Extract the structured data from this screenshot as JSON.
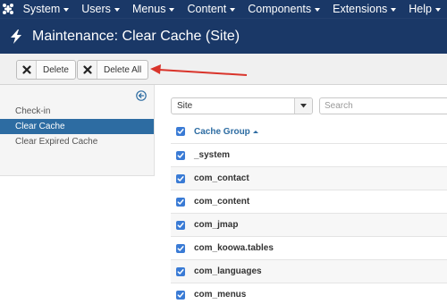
{
  "nav": {
    "logo_icon": "joomla-logo",
    "items": [
      {
        "label": "System",
        "has_caret": true
      },
      {
        "label": "Users",
        "has_caret": true
      },
      {
        "label": "Menus",
        "has_caret": true
      },
      {
        "label": "Content",
        "has_caret": true
      },
      {
        "label": "Components",
        "has_caret": true
      },
      {
        "label": "Extensions",
        "has_caret": true
      },
      {
        "label": "Help",
        "has_caret": true
      }
    ]
  },
  "header": {
    "icon": "lightning-icon",
    "title": "Maintenance: Clear Cache (Site)"
  },
  "toolbar": {
    "delete_label": "Delete",
    "delete_all_label": "Delete All",
    "annotation_color": "#d9342b"
  },
  "sidebar": {
    "collapse_icon": "arrow-left-circle-icon",
    "items": [
      {
        "label": "Check-in",
        "active": false
      },
      {
        "label": "Clear Cache",
        "active": true
      },
      {
        "label": "Clear Expired Cache",
        "active": false
      }
    ]
  },
  "filters": {
    "client_select_value": "Site",
    "search_placeholder": "Search"
  },
  "table": {
    "column_header": "Cache Group",
    "sort_direction": "ascending",
    "rows": [
      {
        "group": "_system",
        "checked": true
      },
      {
        "group": "com_contact",
        "checked": true
      },
      {
        "group": "com_content",
        "checked": true
      },
      {
        "group": "com_jmap",
        "checked": true
      },
      {
        "group": "com_koowa.tables",
        "checked": true
      },
      {
        "group": "com_languages",
        "checked": true
      },
      {
        "group": "com_menus",
        "checked": true
      }
    ]
  },
  "colors": {
    "navbar": "#1a3867",
    "accent": "#2d6ca2",
    "checkbox": "#3a7bd5"
  }
}
